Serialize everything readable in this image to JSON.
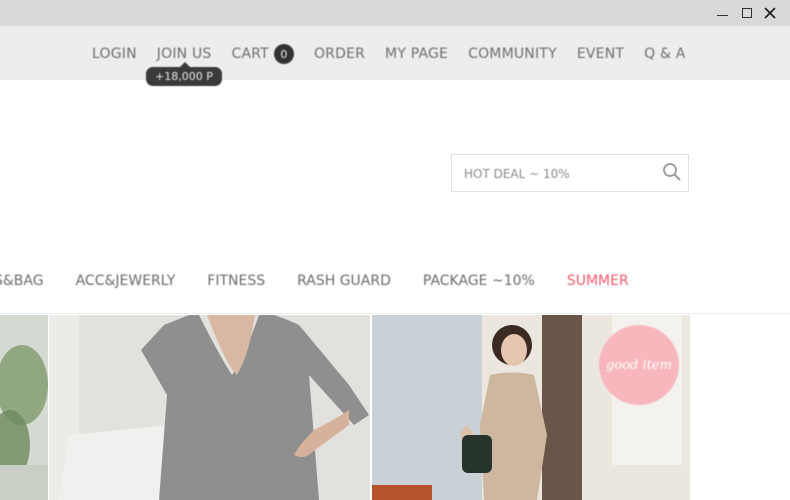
{
  "window": {
    "minimize_icon": "minimize-icon",
    "maximize_icon": "maximize-icon",
    "close_icon": "close-icon"
  },
  "top_nav": {
    "items": [
      "LOGIN",
      "JOIN US",
      "CART",
      "ORDER",
      "MY PAGE",
      "COMMUNITY",
      "EVENT",
      "Q & A"
    ],
    "cart_count": "0",
    "join_tooltip": "+18,000 P"
  },
  "search": {
    "placeholder": "HOT DEAL ~ 10%",
    "icon": "search-icon"
  },
  "category_nav": {
    "items": [
      "S&BAG",
      "ACC&JEWERLY",
      "FITNESS",
      "RASH GUARD",
      "PACKAGE ~10%",
      "SUMMER"
    ],
    "highlight_color": "#f05a6e"
  },
  "products": {
    "badge_text": "good item"
  },
  "colors": {
    "topbar_bg": "#ededed",
    "titlebar_bg": "#d9d9d9",
    "badge_pink": "#f7b7bd"
  }
}
